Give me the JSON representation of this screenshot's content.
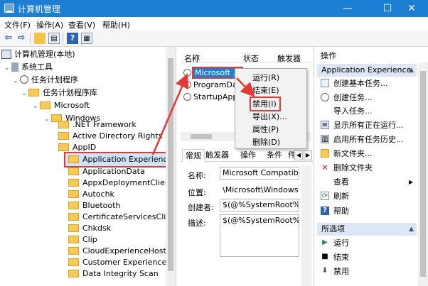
{
  "window": {
    "title": "计算机管理",
    "min": "—",
    "max": "☐",
    "close": "✕"
  },
  "menu": [
    "文件(F)",
    "操作(A)",
    "查看(V)",
    "帮助(H)"
  ],
  "tree": {
    "root": "计算机管理(本地)",
    "system_tools": "系统工具",
    "task_scheduler": "任务计划程序",
    "task_library": "任务计划程序库",
    "microsoft": "Microsoft",
    "windows": "Windows",
    "items": [
      ".NET Framework",
      "Active Directory Rights M",
      "AppID",
      "Application Experience",
      "ApplicationData",
      "AppxDeploymentClient",
      "Autochk",
      "Bluetooth",
      "CertificateServicesClient",
      "Chkdsk",
      "Clip",
      "CloudExperienceHost",
      "Customer Experience Im",
      "Data Integrity Scan"
    ]
  },
  "tasks": {
    "headers": {
      "name": "名称",
      "status": "状态",
      "trigger": "触发器"
    },
    "rows": [
      "Microsoft ...",
      "ProgramDa...",
      "StartupApp..."
    ]
  },
  "context_menu": {
    "run": "运行(R)",
    "end": "结束(E)",
    "disable": "禁用(I)",
    "export": "导出(X)...",
    "properties": "属性(P)",
    "delete": "删除(D)"
  },
  "detail_tabs": [
    "常规",
    "触发器",
    "操作",
    "条件",
    "件"
  ],
  "properties": {
    "name_label": "名称:",
    "name_value": "Microsoft Compatibilit",
    "location_label": "位置:",
    "location_value": "\\Microsoft\\Windows\\A",
    "author_label": "创建者:",
    "author_value": "$(@%SystemRoot%\\sy",
    "desc_label": "描述:",
    "desc_value": "$(@%SystemRoot%\\sy"
  },
  "actions": {
    "header": "操作",
    "section1": "Application Experience",
    "items1": [
      "创建基本任务...",
      "创建任务...",
      "导入任务...",
      "显示所有正在运行...",
      "启用所有任务历史...",
      "新文件夹...",
      "删除文件夹",
      "查看",
      "刷新",
      "帮助"
    ],
    "section2": "所选项",
    "items2": [
      "运行",
      "结束",
      "禁用"
    ]
  },
  "colors": {
    "titlebar": "#1c7fd3",
    "highlight": "#e53935",
    "selection": "#1c7fd3"
  }
}
